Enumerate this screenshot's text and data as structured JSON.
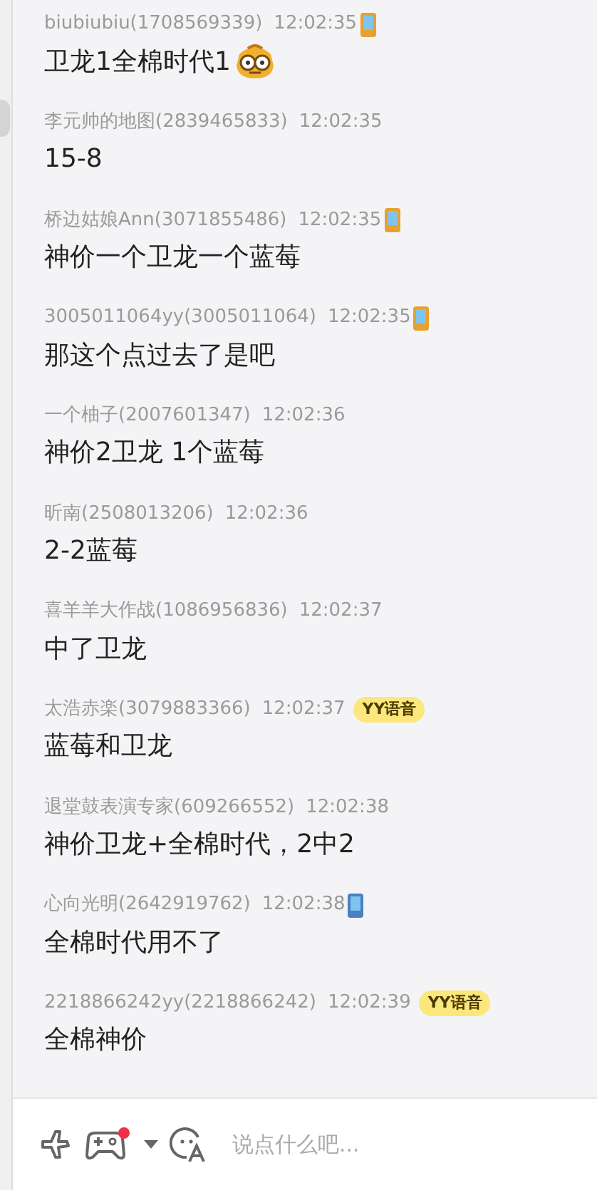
{
  "messages": [
    {
      "sender": "biubiubiu(1708569339)",
      "time": "12:02:35",
      "badge": {
        "kind": "phone",
        "color": "#e8a030"
      },
      "text": "卫龙1全棉时代1",
      "emoji": true
    },
    {
      "sender": "李元帅的地图(2839465833)",
      "time": "12:02:35",
      "text": "15-8",
      "emoji": false
    },
    {
      "sender": "桥边姑娘Ann(3071855486)",
      "time": "12:02:35",
      "badge": {
        "kind": "phone",
        "color": "#e8a030"
      },
      "text": "神价一个卫龙一个蓝莓",
      "emoji": false
    },
    {
      "sender": "3005011064yy(3005011064)",
      "time": "12:02:35",
      "badge": {
        "kind": "phone",
        "color": "#e8a030"
      },
      "text": "那这个点过去了是吧",
      "emoji": false
    },
    {
      "sender": "一个柚子(2007601347)",
      "time": "12:02:36",
      "text": "神价2卫龙 1个蓝莓",
      "emoji": false
    },
    {
      "sender": "昕南(2508013206)",
      "time": "12:02:36",
      "text": "2-2蓝莓",
      "emoji": false
    },
    {
      "sender": "喜羊羊大作战(1086956836)",
      "time": "12:02:37",
      "text": "中了卫龙",
      "emoji": false
    },
    {
      "sender": "太浩赤楽(3079883366)",
      "time": "12:02:37",
      "badge": {
        "kind": "yy",
        "label": "YY语音"
      },
      "text": "蓝莓和卫龙",
      "emoji": false
    },
    {
      "sender": "退堂鼓表演专家(609266552)",
      "time": "12:02:38",
      "text": "神价卫龙+全棉时代，2中2",
      "emoji": false
    },
    {
      "sender": "心向光明(2642919762)",
      "time": "12:02:38",
      "badge": {
        "kind": "phone",
        "color": "#4a7fc0"
      },
      "text": "全棉时代用不了",
      "emoji": false
    },
    {
      "sender": "2218866242yy(2218866242)",
      "time": "12:02:39",
      "badge": {
        "kind": "yy",
        "label": "YY语音"
      },
      "text": "全棉神价",
      "emoji": false
    }
  ],
  "input": {
    "placeholder": "说点什么吧...",
    "game_notification": true
  }
}
